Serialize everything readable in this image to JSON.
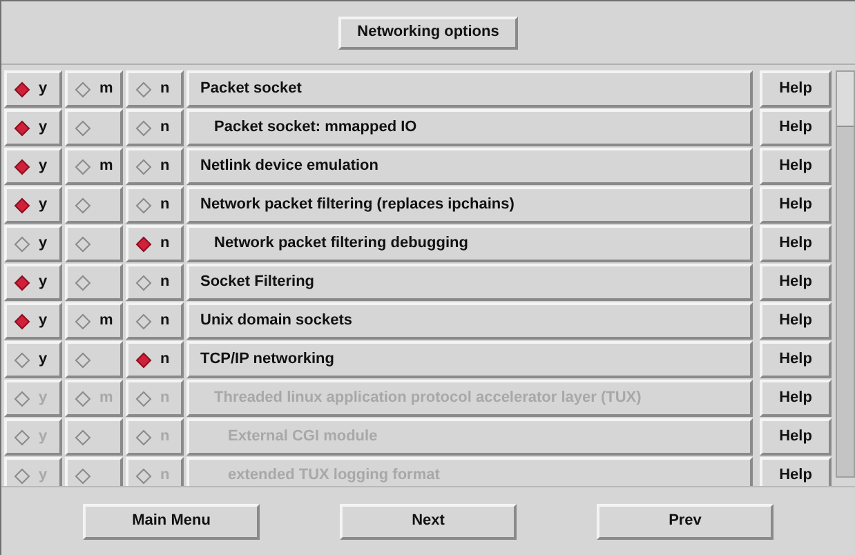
{
  "header_button": "Networking options",
  "rows": [
    {
      "label": "Packet socket",
      "disabled": false,
      "options": [
        {
          "label": "y",
          "selected": true
        },
        {
          "label": "m",
          "selected": false
        },
        {
          "label": "n",
          "selected": false
        }
      ],
      "help": "Help",
      "children": [
        {
          "label": "Packet socket: mmapped IO",
          "disabled": false,
          "options": [
            {
              "label": "y",
              "selected": true
            },
            {
              "selected": false
            },
            {
              "label": "n",
              "selected": false
            }
          ],
          "help": "Help"
        }
      ]
    },
    {
      "label": "Netlink device emulation",
      "disabled": false,
      "options": [
        {
          "label": "y",
          "selected": true
        },
        {
          "label": "m",
          "selected": false
        },
        {
          "label": "n",
          "selected": false
        }
      ],
      "help": "Help"
    },
    {
      "label": "Network packet filtering (replaces ipchains)",
      "disabled": false,
      "options": [
        {
          "label": "y",
          "selected": true
        },
        {
          "selected": false
        },
        {
          "label": "n",
          "selected": false
        }
      ],
      "help": "Help",
      "children": [
        {
          "label": "Network packet filtering debugging",
          "disabled": false,
          "options": [
            {
              "label": "y",
              "selected": false
            },
            {
              "selected": false
            },
            {
              "label": "n",
              "selected": true
            }
          ],
          "help": "Help"
        }
      ]
    },
    {
      "label": "Socket Filtering",
      "disabled": false,
      "options": [
        {
          "label": "y",
          "selected": true
        },
        {
          "selected": false
        },
        {
          "label": "n",
          "selected": false
        }
      ],
      "help": "Help"
    },
    {
      "label": "Unix domain sockets",
      "disabled": false,
      "options": [
        {
          "label": "y",
          "selected": true
        },
        {
          "label": "m",
          "selected": false
        },
        {
          "label": "n",
          "selected": false
        }
      ],
      "help": "Help"
    },
    {
      "label": "TCP/IP networking",
      "disabled": false,
      "options": [
        {
          "label": "y",
          "selected": false
        },
        {
          "selected": false
        },
        {
          "label": "n",
          "selected": true
        }
      ],
      "help": "Help",
      "children": [
        {
          "label": "Threaded linux application protocol accelerator layer (TUX)",
          "disabled": true,
          "options": [
            {
              "label": "y",
              "selected": false
            },
            {
              "label": "m",
              "selected": false
            },
            {
              "label": "n",
              "selected": false
            }
          ],
          "help": "Help",
          "children": [
            {
              "label": "External CGI module",
              "disabled": true,
              "options": [
                {
                  "label": "y",
                  "selected": false
                },
                {
                  "selected": false
                },
                {
                  "label": "n",
                  "selected": false
                }
              ],
              "help": "Help"
            },
            {
              "label": "extended TUX logging format",
              "disabled": true,
              "options": [
                {
                  "label": "y",
                  "selected": false
                },
                {
                  "selected": false
                },
                {
                  "label": "n",
                  "selected": false
                }
              ],
              "help": "Help"
            }
          ]
        }
      ]
    }
  ],
  "buttons": [
    "Main Menu",
    "Next",
    "Prev"
  ]
}
